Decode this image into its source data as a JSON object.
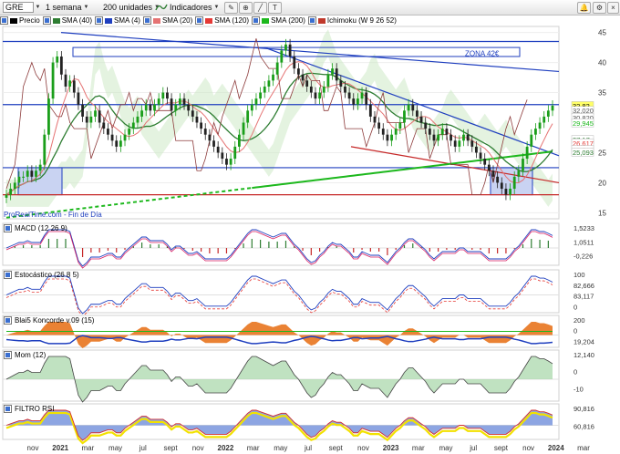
{
  "toolbar": {
    "symbol": "GRE",
    "period": "1 semana",
    "units": "200 unidades",
    "indicators": "Indicadores"
  },
  "main_legend": [
    {
      "label": "Precio",
      "color": "#000000"
    },
    {
      "label": "SMA (40)",
      "color": "#2e7d32"
    },
    {
      "label": "SMA (4)",
      "color": "#1f3fbf"
    },
    {
      "label": "SMA (20)",
      "color": "#e57373"
    },
    {
      "label": "SMA (120)",
      "color": "#e53935"
    },
    {
      "label": "SMA (200)",
      "color": "#1db81d"
    },
    {
      "label": "Ichimoku (W 9 26 52)",
      "color": "#c0392b"
    }
  ],
  "zone_label": "ZONA 42€",
  "watermark": "ProRealTime.com - Fin de Día",
  "price_axis": [
    {
      "label": "45",
      "v": 45
    },
    {
      "label": "40",
      "v": 40
    },
    {
      "label": "35",
      "v": 35
    },
    {
      "label": "25",
      "v": 25
    },
    {
      "label": "20",
      "v": 20
    },
    {
      "label": "15",
      "v": 15
    }
  ],
  "price_tags": [
    {
      "label": "32,82",
      "v": 32.82,
      "bg": "#ffff66",
      "fg": "#000000"
    },
    {
      "label": "32,020",
      "v": 32.02,
      "bg": "#ffffff",
      "fg": "#555555"
    },
    {
      "label": "30,820",
      "v": 30.82,
      "bg": "#ffffff",
      "fg": "#555555"
    },
    {
      "label": "29,945",
      "v": 29.945,
      "bg": "#ffffff",
      "fg": "#1db81d"
    },
    {
      "label": "27,17",
      "v": 27.17,
      "bg": "#ffffff",
      "fg": "#2e7d32"
    },
    {
      "label": "26,617",
      "v": 26.617,
      "bg": "#ffffff",
      "fg": "#e53935"
    },
    {
      "label": "25,518",
      "v": 25.518,
      "bg": "#ffffff",
      "fg": "#e57373"
    },
    {
      "label": "25,093",
      "v": 25.093,
      "bg": "#ffffff",
      "fg": "#2e7d32"
    }
  ],
  "x_axis": [
    "nov",
    "2021",
    "mar",
    "may",
    "jul",
    "sept",
    "nov",
    "2022",
    "mar",
    "may",
    "jul",
    "sept",
    "nov",
    "2023",
    "mar",
    "may",
    "jul",
    "sept",
    "nov",
    "2024",
    "mar"
  ],
  "bold_x_labels": [
    "2021",
    "2022",
    "2023",
    "2024"
  ],
  "panels": [
    {
      "id": "macd",
      "label": "MACD (12 26 9)",
      "axis": [
        "1,5233",
        "1,0511",
        "-0,226"
      ]
    },
    {
      "id": "stoch",
      "label": "Estocástico (26 8 5)",
      "axis": [
        "100",
        "82,666",
        "83,117",
        "0"
      ]
    },
    {
      "id": "blai",
      "label": "Blai5 Koncorde v.09 (15)",
      "axis": [
        "200",
        "0",
        "19,204"
      ]
    },
    {
      "id": "mom",
      "label": "Mom (12)",
      "axis": [
        "12,140",
        "0",
        "-10"
      ]
    },
    {
      "id": "rsi",
      "label": "FILTRO RSI",
      "axis": [
        "90,816",
        "60,816"
      ]
    }
  ],
  "chart_data": {
    "type": "candlestick",
    "title": "GRE",
    "x_range": [
      "2020-10",
      "2024-03"
    ],
    "ylim": [
      14,
      46
    ],
    "close_series_weekly_approx": [
      18,
      19,
      20,
      21,
      21,
      22,
      21,
      22,
      23,
      28,
      34,
      40,
      41,
      38,
      36,
      37,
      35,
      33,
      31,
      30,
      31,
      32,
      30,
      29,
      28,
      27,
      26,
      27,
      28,
      29,
      30,
      31,
      32,
      33,
      32,
      33,
      34,
      35,
      34,
      32,
      33,
      34,
      33,
      32,
      31,
      30,
      29,
      28,
      27,
      26,
      25,
      24,
      23,
      24,
      26,
      28,
      30,
      32,
      33,
      34,
      35,
      36,
      37,
      38,
      40,
      42,
      43,
      41,
      39,
      38,
      37,
      36,
      35,
      34,
      35,
      36,
      38,
      39,
      37,
      36,
      35,
      34,
      33,
      34,
      35,
      33,
      31,
      30,
      29,
      28,
      27,
      28,
      29,
      30,
      32,
      33,
      32,
      31,
      30,
      29,
      28,
      27,
      28,
      29,
      28,
      27,
      26,
      27,
      28,
      27,
      26,
      25,
      24,
      23,
      22,
      21,
      20,
      19,
      18,
      19,
      21,
      22,
      24,
      26,
      28,
      29,
      30,
      31,
      32,
      32.82
    ],
    "annotations": [
      {
        "text": "ZONA 42€",
        "y": 41.5
      },
      {
        "text": "32,82",
        "y": 32.82
      }
    ],
    "horizontal_levels": [
      {
        "y": 43.5,
        "color": "#1f3fbf"
      },
      {
        "y": 33.0,
        "color": "#1f3fbf"
      },
      {
        "y": 22.5,
        "color": "#1f3fbf"
      },
      {
        "y": 18.0,
        "color": "#c62828"
      }
    ],
    "last_close": 32.82
  }
}
